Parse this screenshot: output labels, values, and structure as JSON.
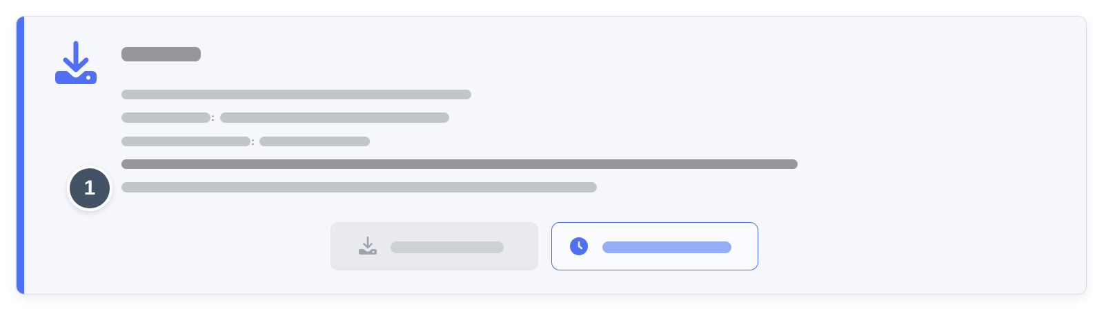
{
  "card": {
    "accent_color": "#4f6ff5",
    "icon": "download-tray-icon",
    "step_number": "1",
    "title": "",
    "description": "",
    "detail_rows": [
      {
        "label": "",
        "value": ""
      },
      {
        "label": "",
        "value": ""
      }
    ],
    "highlight_line": "",
    "note_line": ""
  },
  "actions": {
    "download": {
      "label": "",
      "icon": "download-tray-icon",
      "state": "disabled"
    },
    "later": {
      "label": "",
      "icon": "clock-icon",
      "accent": "#4b6ae8"
    }
  }
}
